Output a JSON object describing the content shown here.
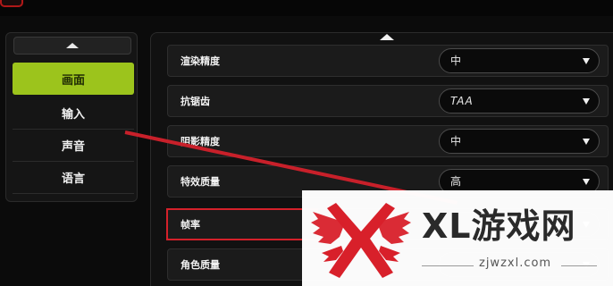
{
  "sidebar": {
    "items": [
      {
        "label": "画面",
        "active": true
      },
      {
        "label": "输入",
        "active": false
      },
      {
        "label": "声音",
        "active": false
      },
      {
        "label": "语言",
        "active": false
      }
    ]
  },
  "settings": {
    "rows": [
      {
        "label": "渲染精度",
        "value": "中"
      },
      {
        "label": "抗锯齿",
        "value": "TAA"
      },
      {
        "label": "阴影精度",
        "value": "中"
      },
      {
        "label": "特效质量",
        "value": "高"
      },
      {
        "label": "帧率",
        "value": ""
      },
      {
        "label": "角色质量",
        "value": ""
      }
    ]
  },
  "watermark": {
    "brand": "XL游戏网",
    "url": "zjwzxl.com"
  },
  "colors": {
    "accent": "#9cc41c",
    "highlight": "#d4212a"
  }
}
